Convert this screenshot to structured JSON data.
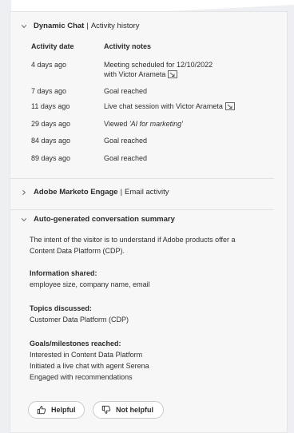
{
  "dynamic_chat": {
    "title_bold": "Dynamic Chat",
    "separator": "|",
    "title_rest": "Activity history",
    "columns": [
      "Activity date",
      "Activity notes"
    ],
    "rows": [
      {
        "date": "4 days ago",
        "note": "Meeting scheduled for 12/10/2022",
        "note2": "with Victor Arameta",
        "link_icon": true
      },
      {
        "date": "7 days ago",
        "note": "Goal reached",
        "note2": "",
        "link_icon": false
      },
      {
        "date": "11 days ago",
        "note": "Live chat session with Victor Arameta",
        "note2": "",
        "link_icon": true
      },
      {
        "date": "29 days ago",
        "note": "Viewed",
        "note_italic": "'AI for marketing'",
        "note2": "",
        "link_icon": false
      },
      {
        "date": "84 days ago",
        "note": "Goal reached",
        "note2": "",
        "link_icon": false
      },
      {
        "date": "89 days ago",
        "note": "Goal reached",
        "note2": "",
        "link_icon": false
      }
    ]
  },
  "marketo": {
    "title_bold": "Adobe Marketo Engage",
    "separator": "|",
    "title_rest": "Email activity"
  },
  "summary": {
    "title": "Auto-generated conversation summary",
    "intro_line1": "The intent of the visitor is to understand if Adobe products offer a",
    "intro_line2": "Content Data Platform (CDP).",
    "info_title": "Information shared:",
    "info_text": "employee size, company name, email",
    "topics_title": "Topics discussed:",
    "topics_text": "Customer Data Platform (CDP)",
    "goals_title": "Goals/milestones reached:",
    "goals": [
      "Interested in Content Data Platform",
      "Initiated a live chat with agent Serena",
      "Engaged with recommendations"
    ]
  },
  "feedback": {
    "helpful_label": "Helpful",
    "not_helpful_label": "Not helpful"
  }
}
